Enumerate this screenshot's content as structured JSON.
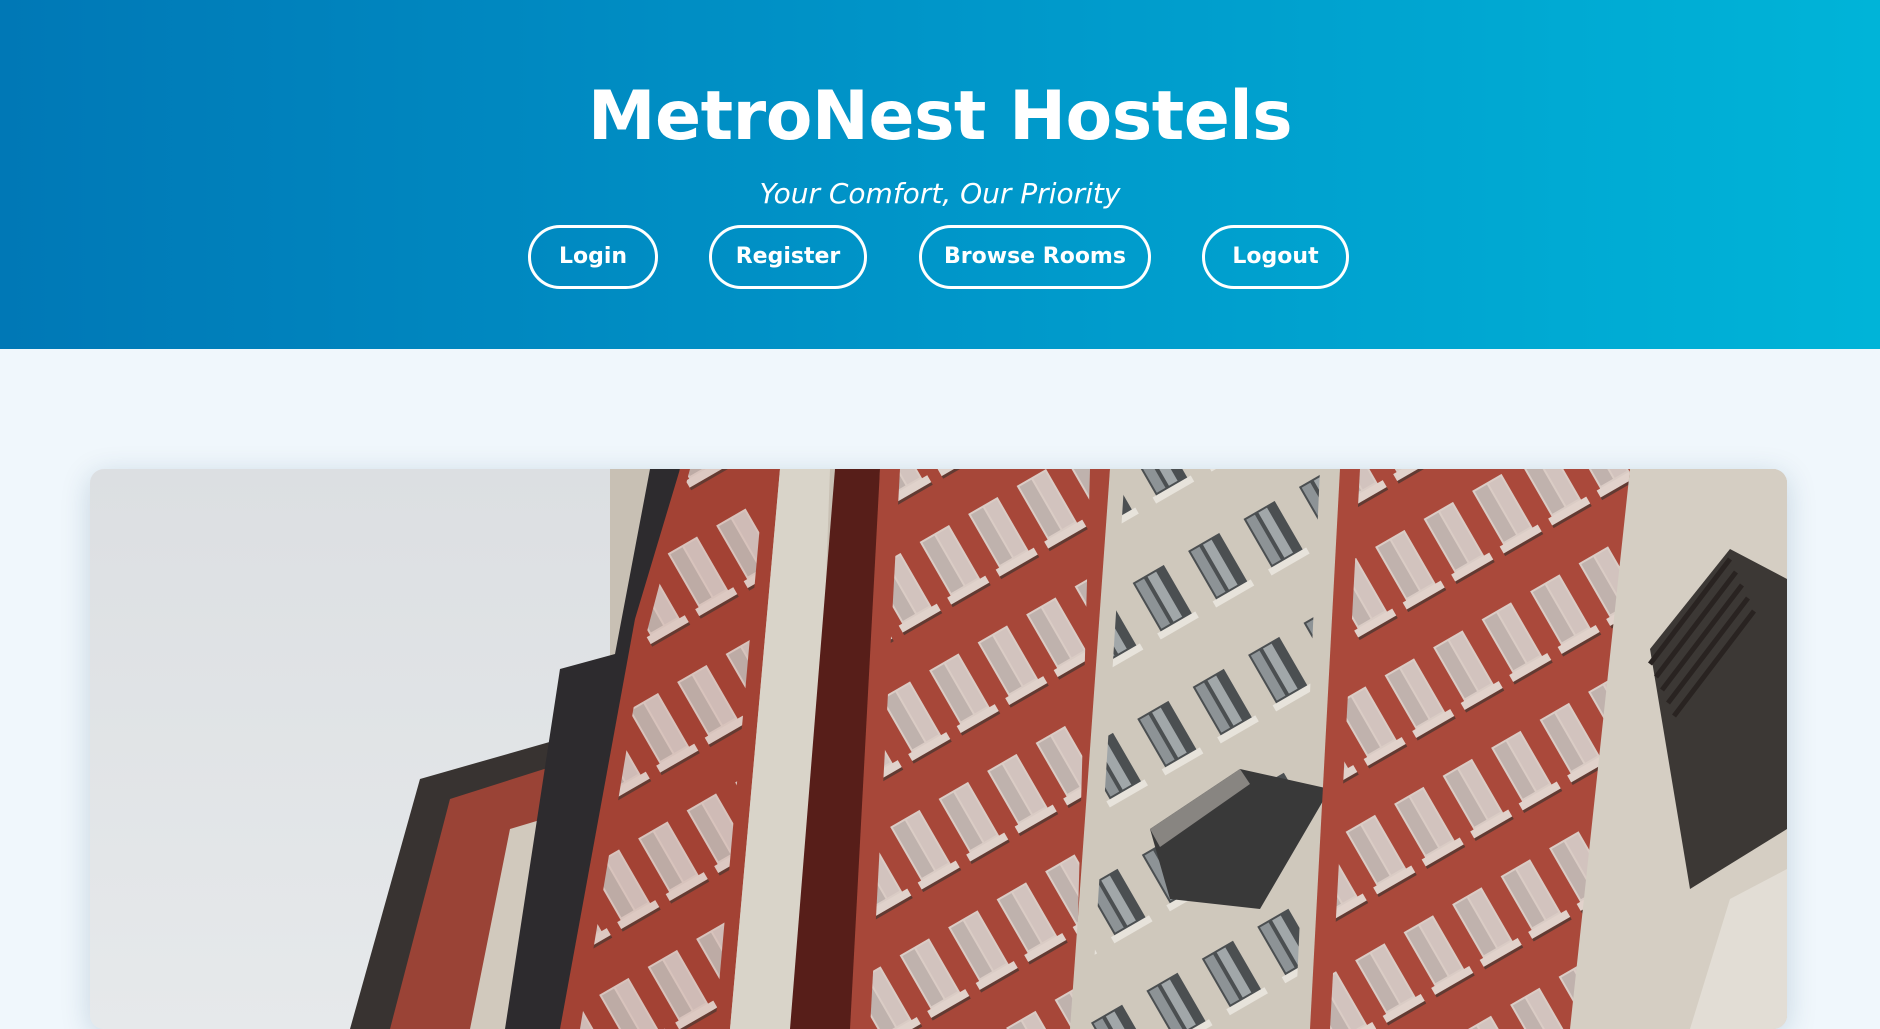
{
  "header": {
    "title": "MetroNest Hostels",
    "tagline": "Your Comfort, Our Priority",
    "nav": [
      {
        "label": "Login"
      },
      {
        "label": "Register"
      },
      {
        "label": "Browse Rooms"
      },
      {
        "label": "Logout"
      }
    ]
  },
  "hero": {
    "image_subject": "hostel-building-photo"
  },
  "colors": {
    "header_gradient_start": "#0078b6",
    "header_gradient_end": "#00b4d8",
    "page_background": "#f0f7fc",
    "building_red": "#b24a3c",
    "building_cream": "#d9d2c6"
  }
}
